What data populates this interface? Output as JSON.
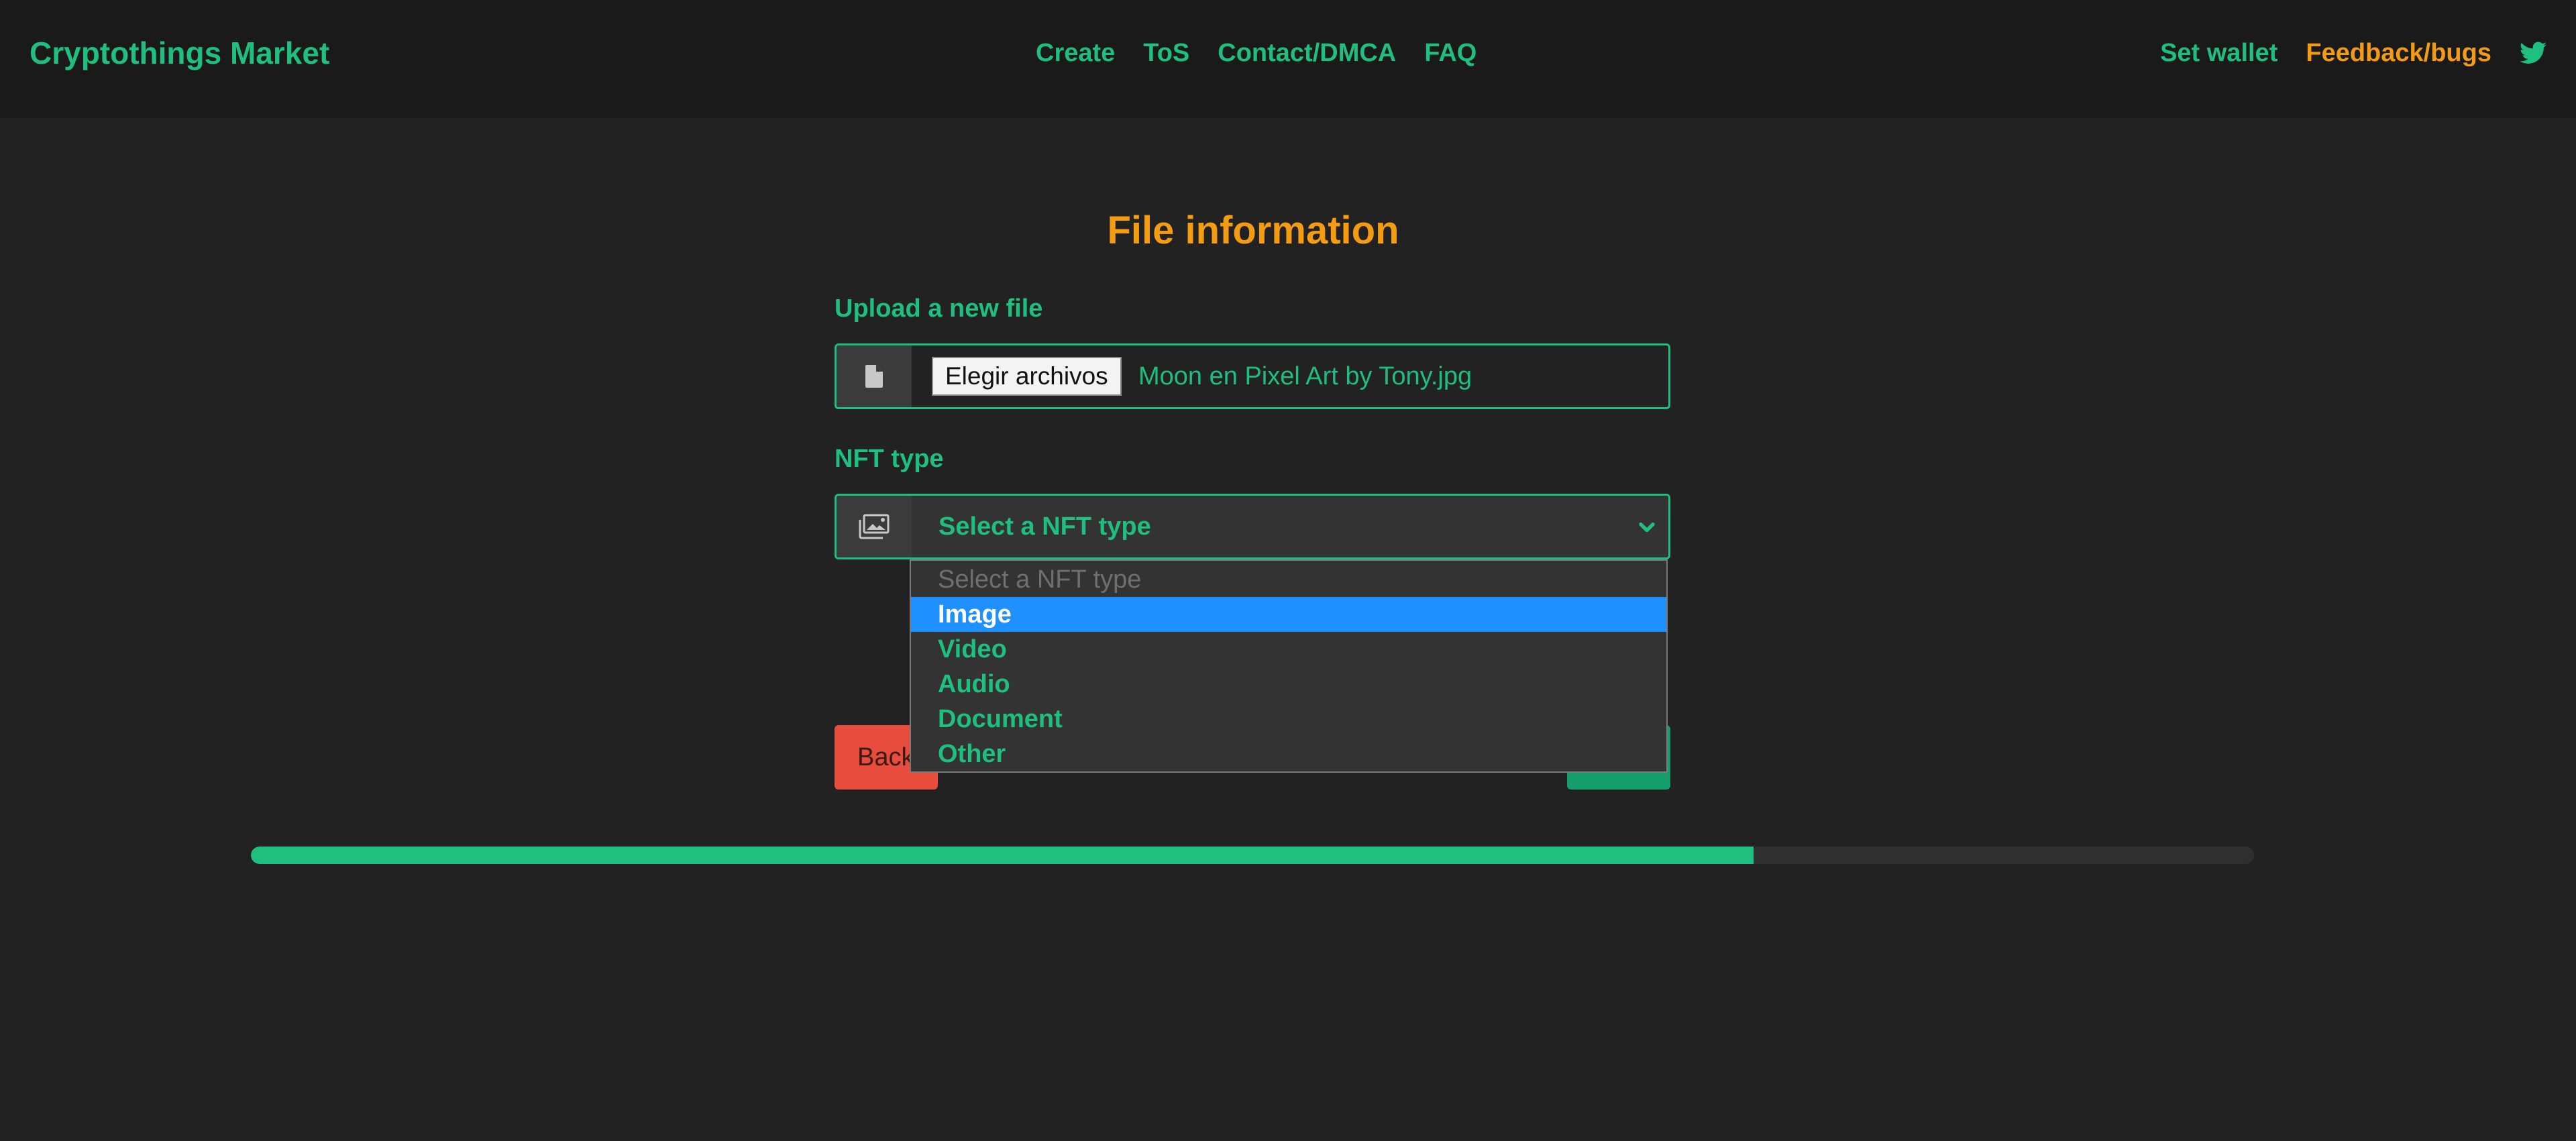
{
  "navbar": {
    "brand": "Cryptothings Market",
    "links": [
      "Create",
      "ToS",
      "Contact/DMCA",
      "FAQ"
    ],
    "set_wallet": "Set wallet",
    "feedback": "Feedback/bugs",
    "twitter_icon": "twitter-icon"
  },
  "form": {
    "title": "File information",
    "upload_label": "Upload a new file",
    "file_button": "Elegir archivos",
    "file_name": "Moon en Pixel Art by Tony.jpg",
    "file_icon": "file-icon",
    "nft_type_label": "NFT type",
    "nft_type_icon": "images-icon",
    "nft_type_value": "Select a NFT type",
    "nft_type_options": [
      {
        "label": "Select a NFT type",
        "placeholder": true
      },
      {
        "label": "Image",
        "highlighted": true
      },
      {
        "label": "Video"
      },
      {
        "label": "Audio"
      },
      {
        "label": "Document"
      },
      {
        "label": "Other"
      }
    ],
    "back_button": "Back"
  },
  "progress": {
    "value": 0.75
  },
  "colors": {
    "accent": "#1fbf7f",
    "orange": "#f39c12",
    "danger": "#e74c3c",
    "highlight": "#1e90ff",
    "background": "#222222"
  }
}
